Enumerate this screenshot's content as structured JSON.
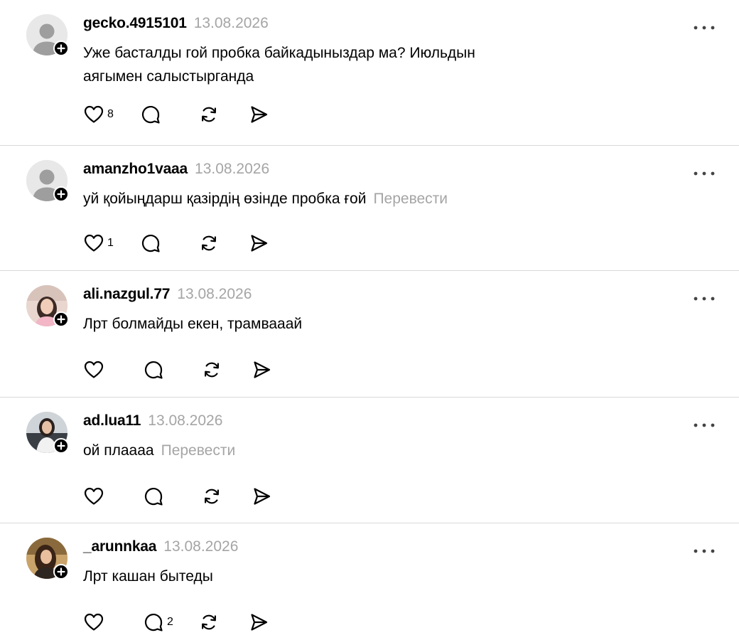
{
  "posts": [
    {
      "username": "gecko.4915101",
      "date": "13.08.2026",
      "text_lines": [
        "Уже басталды гой пробка байкадыныздар ма? Июльдын",
        "аягымен салыстырганда"
      ],
      "translate": "",
      "likes": "8",
      "replies": "",
      "avatar": "default-user-icon"
    },
    {
      "username": "amanzho1vaaa",
      "date": "13.08.2026",
      "text_lines": [
        "уй қойыңдарш қазірдің өзінде пробка ғой"
      ],
      "translate": "Перевести",
      "likes": "1",
      "replies": "",
      "avatar": "default-user-icon"
    },
    {
      "username": "ali.nazgul.77",
      "date": "13.08.2026",
      "text_lines": [
        "Лрт болмайды екен, трамвааай"
      ],
      "translate": "",
      "likes": "",
      "replies": "",
      "avatar": "photo-avatar"
    },
    {
      "username": "ad.lua11",
      "date": "13.08.2026",
      "text_lines": [
        "ой плаааа"
      ],
      "translate": "Перевести",
      "likes": "",
      "replies": "",
      "avatar": "photo-avatar"
    },
    {
      "username": "_arunnkaa",
      "date": "13.08.2026",
      "text_lines": [
        "Лрт кашан бытеды"
      ],
      "translate": "",
      "likes": "",
      "replies": "2",
      "avatar": "photo-avatar"
    }
  ],
  "colors": {
    "text": "#000000",
    "muted": "#a5a5a5",
    "divider": "#d9d9d9",
    "avatar_bg": "#e8e8e8",
    "avatar_figure": "#9e9e9e"
  },
  "icons": {
    "like": "heart-icon",
    "reply": "comment-bubble-icon",
    "repost": "repost-arrows-icon",
    "share": "send-plane-icon",
    "more": "more-dots-icon",
    "follow": "plus-badge-icon"
  }
}
